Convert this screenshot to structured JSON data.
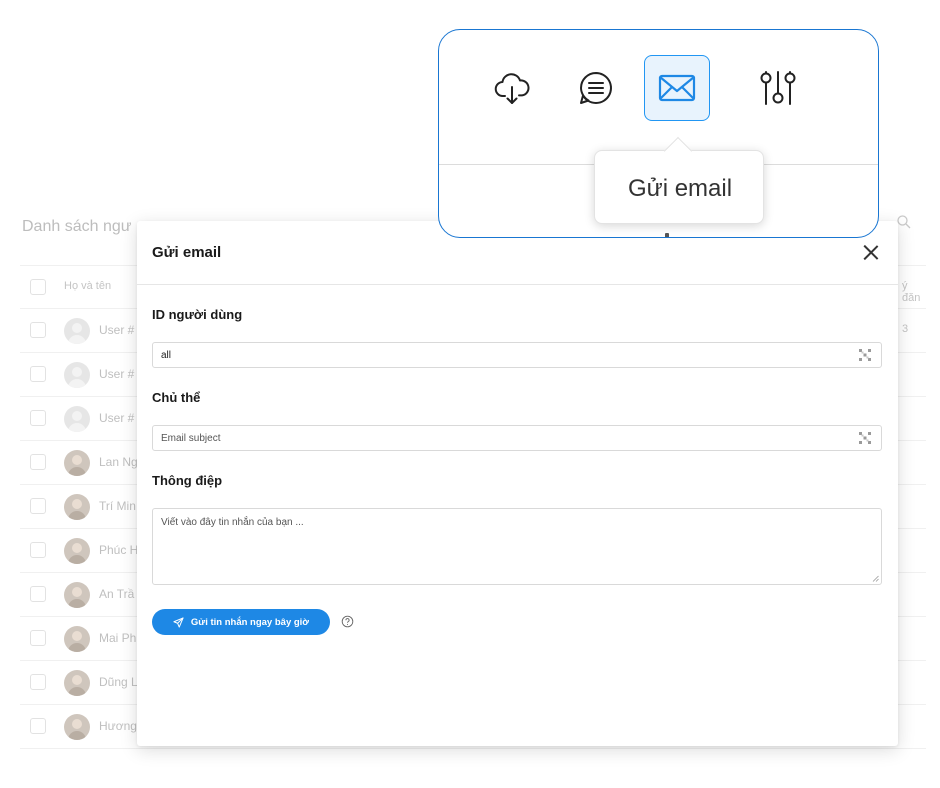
{
  "background": {
    "list_title": "Danh sách ngư",
    "header": {
      "name_column": "Họ và tên",
      "right_column": "ý đăn"
    },
    "rows": [
      {
        "name": "User #",
        "right": "3",
        "avatar": "placeholder"
      },
      {
        "name": "User #",
        "right": "",
        "avatar": "placeholder"
      },
      {
        "name": "User #",
        "right": "",
        "avatar": "placeholder"
      },
      {
        "name": "Lan Ng",
        "right": "",
        "avatar": "photo"
      },
      {
        "name": "Trí Min",
        "right": "",
        "avatar": "photo"
      },
      {
        "name": "Phúc H",
        "right": "",
        "avatar": "photo"
      },
      {
        "name": "An Trầ",
        "right": "",
        "avatar": "photo"
      },
      {
        "name": "Mai Ph",
        "right": "",
        "avatar": "photo"
      },
      {
        "name": "Dũng L",
        "right": "",
        "avatar": "photo"
      },
      {
        "name": "Hương",
        "right": "",
        "avatar": "photo"
      }
    ]
  },
  "modal": {
    "title": "Gửi email",
    "user_id": {
      "label": "ID người dùng",
      "value": "all"
    },
    "subject": {
      "label": "Chủ thể",
      "placeholder": "Email subject"
    },
    "message": {
      "label": "Thông điệp",
      "placeholder": "Viết vào đây tin nhắn của bạn ..."
    },
    "send_button": "Gửi tin nhắn ngay bây giờ"
  },
  "callout": {
    "icons": [
      "cloud-download-icon",
      "chat-icon",
      "mail-icon",
      "sliders-icon"
    ],
    "active_icon": "mail-icon",
    "tooltip": "Gửi email"
  },
  "colors": {
    "accent": "#1e88e5",
    "callout_border": "#1976d2",
    "active_icon_bg": "#e8f3fd"
  }
}
